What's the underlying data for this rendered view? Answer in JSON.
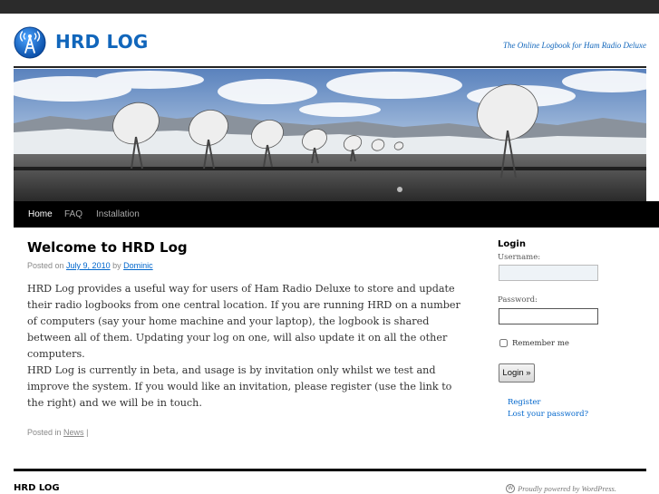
{
  "site": {
    "title": "HRD LOG",
    "tagline": "The Online Logbook for Ham Radio Deluxe"
  },
  "nav": {
    "items": [
      {
        "label": "Home",
        "current": true
      },
      {
        "label": "FAQ",
        "current": false
      },
      {
        "label": "Installation",
        "current": false
      }
    ]
  },
  "post": {
    "title": "Welcome to HRD Log",
    "meta": {
      "posted_on": "Posted on",
      "date": "July 9, 2010",
      "by": "by",
      "author": "Dominic"
    },
    "paragraphs": [
      "HRD Log provides a useful way for users of  Ham Radio Deluxe to store and update their radio logbooks from one central location. If you are running HRD on a number of computers (say your home machine and your laptop), the logbook is shared between all of them. Updating your log on one, will also update it on all the other computers.",
      "HRD Log is currently in beta, and usage is by invitation only whilst we test and improve the system. If you would like an invitation, please register (use the link to the right) and we will be in touch."
    ],
    "posted_in": "Posted in",
    "category": "News",
    "separator": "|"
  },
  "sidebar": {
    "title": "Login",
    "username_label": "Username:",
    "username_value": "",
    "password_label": "Password:",
    "password_value": "",
    "remember_label": "Remember me",
    "login_button": "Login »",
    "register_link": "Register",
    "lost_password_link": "Lost your password?"
  },
  "footer": {
    "title": "HRD LOG",
    "powered_by": "Proudly powered by WordPress."
  },
  "colors": {
    "brand_blue": "#1166bb",
    "link_blue": "#0066cc",
    "nav_bg": "#000000"
  },
  "icons": {
    "logo": "radio-tower-icon",
    "powered": "wordpress-icon"
  }
}
